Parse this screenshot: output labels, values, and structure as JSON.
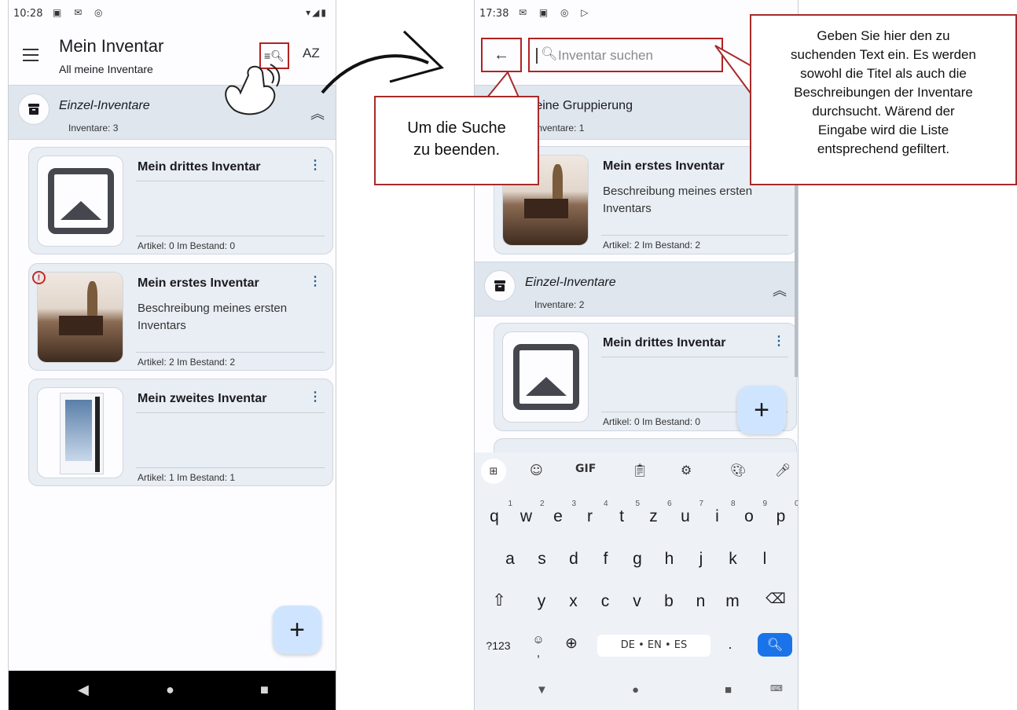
{
  "left_screen": {
    "status": {
      "time": "10:28"
    },
    "appbar": {
      "title": "Mein Inventar",
      "subtitle": "All meine Inventare",
      "sort_label": "AZ"
    },
    "group": {
      "title": "Einzel-Inventare",
      "count": "Inventare: 3"
    },
    "cards": [
      {
        "title": "Mein drittes Inventar",
        "description": "",
        "meta": "Artikel: 0   Im Bestand: 0",
        "image": "placeholder-image"
      },
      {
        "title": "Mein erstes Inventar",
        "description": "Beschreibung meines ersten Inventars",
        "meta": "Artikel: 2   Im Bestand: 2",
        "image": "dining-room-photo",
        "warning": "!"
      },
      {
        "title": "Mein zweites Inventar",
        "description": "",
        "meta": "Artikel: 1   Im Bestand: 1",
        "image": "pc-case-photo"
      }
    ],
    "fab_label": "+"
  },
  "right_screen": {
    "status": {
      "time": "17:38"
    },
    "search": {
      "placeholder": "Inventar suchen"
    },
    "group1": {
      "title": "Meine Gruppierung",
      "count": "Inventare: 1"
    },
    "card1": {
      "title": "Mein erstes Inventar",
      "description": "Beschreibung meines ersten Inventars",
      "meta": "Artikel: 2   Im Bestand: 2"
    },
    "group2": {
      "title": "Einzel-Inventare",
      "count": "Inventare: 2"
    },
    "card2": {
      "title": "Mein drittes Inventar",
      "meta": "Artikel: 0   Im Bestand: 0"
    },
    "fab_label": "+",
    "keyboard": {
      "gif_label": "GIF",
      "row1": [
        {
          "key": "q",
          "num": "1"
        },
        {
          "key": "w",
          "num": "2"
        },
        {
          "key": "e",
          "num": "3"
        },
        {
          "key": "r",
          "num": "4"
        },
        {
          "key": "t",
          "num": "5"
        },
        {
          "key": "z",
          "num": "6"
        },
        {
          "key": "u",
          "num": "7"
        },
        {
          "key": "i",
          "num": "8"
        },
        {
          "key": "o",
          "num": "9"
        },
        {
          "key": "p",
          "num": "0"
        }
      ],
      "row2": [
        "a",
        "s",
        "d",
        "f",
        "g",
        "h",
        "j",
        "k",
        "l"
      ],
      "row3": [
        "y",
        "x",
        "c",
        "v",
        "b",
        "n",
        "m"
      ],
      "numbers_label": "?123",
      "comma_label": ",",
      "space_label": "DE • EN • ES",
      "period_label": "."
    }
  },
  "annotations": {
    "back_callout": "Um die Suche\nzu beenden.",
    "search_callout": "Geben Sie hier den zu\nsuchenden Text ein. Es werden\nsowohl die Titel als auch die\nBeschreibungen der Inventare\ndurchsucht. Wärend der\nEingabe wird die Liste\nentsprechend gefiltert."
  },
  "colors": {
    "accent_fab": "#cfe5ff",
    "group_header_bg": "#dfe6ee",
    "card_bg": "#e9eef4",
    "annotation_red": "#b22222",
    "keyboard_enter": "#1a73e8"
  }
}
